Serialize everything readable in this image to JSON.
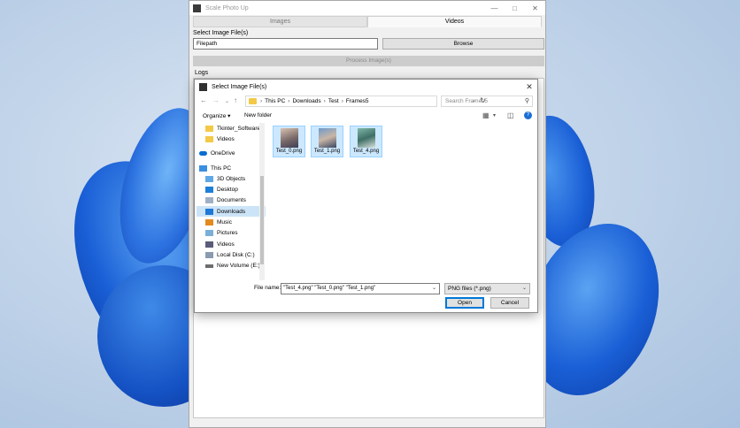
{
  "app": {
    "title": "Scale Photo Up",
    "tabs": [
      {
        "label": "Images",
        "active": false
      },
      {
        "label": "Videos",
        "active": true
      }
    ],
    "select_label": "Select Image File(s)",
    "filepath_value": "Filepath",
    "browse_label": "Browse",
    "process_label": "Process Image(s)",
    "logs_label": "Logs"
  },
  "dialog": {
    "title": "Select Image File(s)",
    "breadcrumb": [
      "This PC",
      "Downloads",
      "Test",
      "Frames5"
    ],
    "search_placeholder": "Search Frames5",
    "organize_label": "Organize",
    "new_folder_label": "New folder",
    "nav_items": [
      {
        "label": "Tkinter_Software",
        "icon": "folder-icon"
      },
      {
        "label": "Videos",
        "icon": "folder-icon"
      },
      {
        "label": "",
        "icon": ""
      },
      {
        "label": "OneDrive",
        "icon": "cloud-icon"
      },
      {
        "label": "",
        "icon": ""
      },
      {
        "label": "This PC",
        "icon": "computer-icon"
      },
      {
        "label": "3D Objects",
        "icon": "cube-icon"
      },
      {
        "label": "Desktop",
        "icon": "desktop-icon"
      },
      {
        "label": "Documents",
        "icon": "documents-icon"
      },
      {
        "label": "Downloads",
        "icon": "download-icon",
        "selected": true
      },
      {
        "label": "Music",
        "icon": "music-icon"
      },
      {
        "label": "Pictures",
        "icon": "pictures-icon"
      },
      {
        "label": "Videos",
        "icon": "videos-icon"
      },
      {
        "label": "Local Disk (C:)",
        "icon": "disk-icon"
      },
      {
        "label": "New Volume (E:)",
        "icon": "drive-icon"
      }
    ],
    "files": [
      {
        "name": "Test_0.png"
      },
      {
        "name": "Test_1.png"
      },
      {
        "name": "Test_4.png"
      }
    ],
    "file_name_label": "File name:",
    "file_name_value": "\"Test_4.png\" \"Test_0.png\" \"Test_1.png\"",
    "file_type_value": "PNG files (*.png)",
    "open_label": "Open",
    "cancel_label": "Cancel"
  },
  "colors": {
    "accent": "#0078d7",
    "selection": "#cce8ff",
    "wallpaper_blue": "#1a5fd6"
  }
}
